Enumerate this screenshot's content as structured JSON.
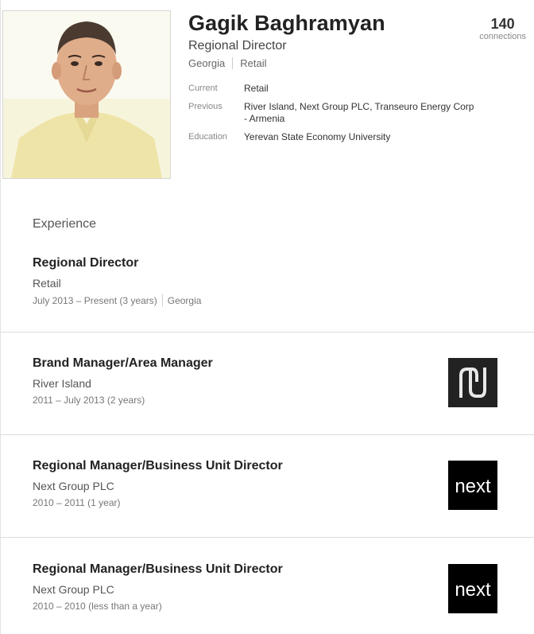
{
  "profile": {
    "name": "Gagik Baghramyan",
    "headline": "Regional Director",
    "location": "Georgia",
    "industry": "Retail",
    "connections_count": "140",
    "connections_label": "connections",
    "facts": [
      {
        "label": "Current",
        "value": "Retail"
      },
      {
        "label": "Previous",
        "value": "River Island, Next Group PLC, Transeuro Energy Corp - Armenia"
      },
      {
        "label": "Education",
        "value": "Yerevan State Economy University"
      }
    ]
  },
  "experience": {
    "heading": "Experience",
    "jobs": [
      {
        "title": "Regional Director",
        "company": "Retail",
        "dates": "July 2013 – Present (3 years)",
        "location": "Georgia",
        "logo": ""
      },
      {
        "title": "Brand Manager/Area Manager",
        "company": "River Island",
        "dates": "2011 – July 2013 (2 years)",
        "location": "",
        "logo": "river-island-logo"
      },
      {
        "title": "Regional Manager/Business Unit Director",
        "company": "Next Group PLC",
        "dates": "2010 – 2011 (1 year)",
        "location": "",
        "logo": "next-logo",
        "logo_text": "next"
      },
      {
        "title": "Regional Manager/Business Unit Director",
        "company": "Next Group PLC",
        "dates": "2010 – 2010 (less than a year)",
        "location": "",
        "logo": "next-logo",
        "logo_text": "next"
      }
    ]
  },
  "colors": {
    "name": "#222222",
    "muted": "#888888",
    "divider": "#dcdcdc",
    "logo_bg": "#000000"
  }
}
